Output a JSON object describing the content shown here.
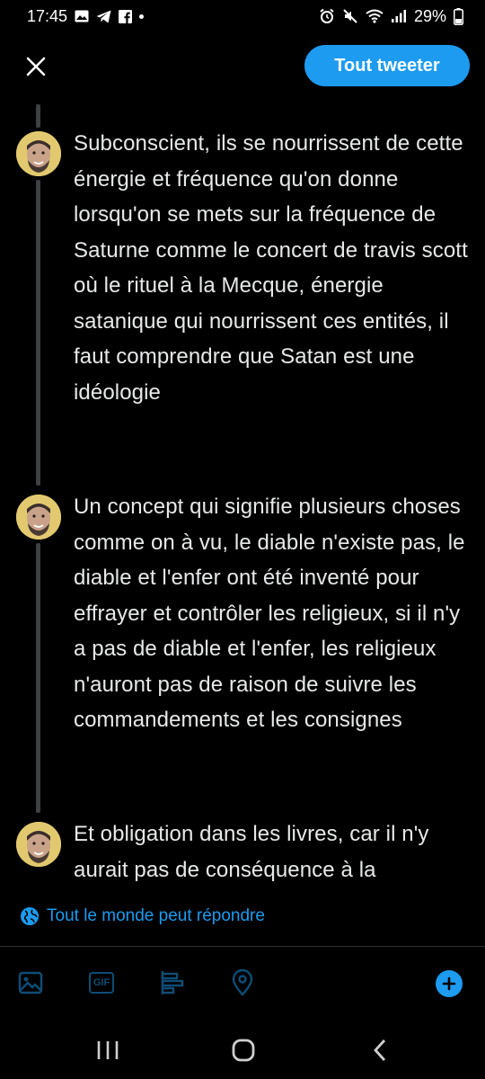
{
  "status_bar": {
    "time": "17:45",
    "left_icons": [
      "image-icon",
      "telegram-icon",
      "facebook-icon",
      "dot-icon"
    ],
    "right_icons": [
      "alarm-icon",
      "mute-icon",
      "wifi-icon",
      "signal-icon"
    ],
    "battery": "29%"
  },
  "top_bar": {
    "close_icon": "close-icon",
    "tweet_button": "Tout tweeter"
  },
  "thread": {
    "tweets": [
      {
        "text": "Subconscient, ils se nourrissent de cette énergie et fréquence qu'on donne lorsqu'on se mets sur la fréquence de Saturne comme le concert de travis scott où le rituel à la Mecque, énergie satanique qui nourrissent ces entités, il faut comprendre que Satan est une idéologie"
      },
      {
        "text": "Un concept qui signifie plusieurs choses comme on à vu, le diable n'existe pas, le diable et l'enfer ont été inventé pour effrayer et contrôler les religieux, si il n'y a pas de diable et l'enfer, les religieux n'auront pas de raison de suivre les commandements et les consignes"
      },
      {
        "text": "Et obligation dans les livres, car il n'y aurait pas de conséquence à la"
      }
    ]
  },
  "reply_setting": {
    "icon": "globe-icon",
    "label": "Tout le monde peut répondre"
  },
  "toolbar": {
    "icons": [
      "image-icon",
      "gif-icon",
      "poll-icon",
      "location-icon",
      "add-icon"
    ],
    "gif_label": "GIF"
  },
  "nav_bar": {
    "icons": [
      "recent-apps-icon",
      "home-icon",
      "back-icon"
    ]
  },
  "colors": {
    "accent": "#1d9bf0",
    "background": "#000000",
    "text": "#e7e9ea",
    "thread_line": "#3e4144"
  }
}
